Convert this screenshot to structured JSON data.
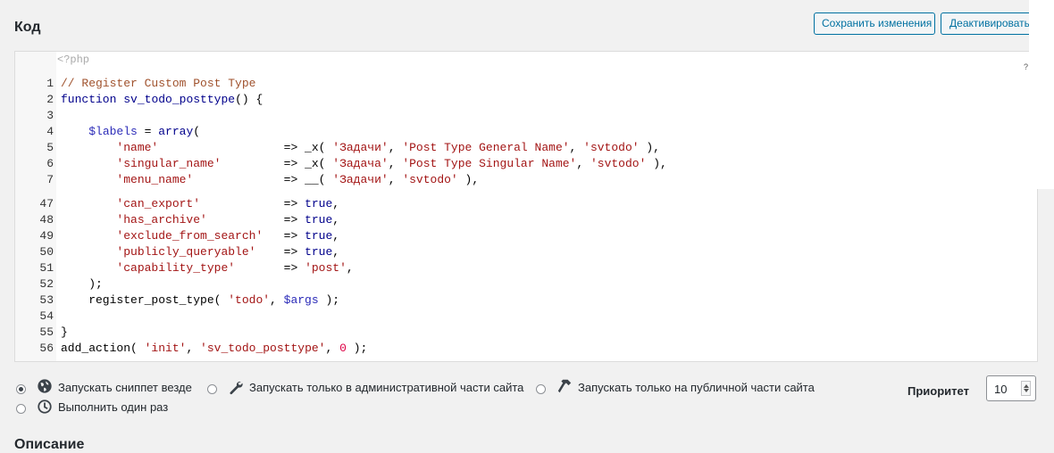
{
  "section_title": "Код",
  "buttons": {
    "save": "Сохранить изменения",
    "deactivate": "Деактивировать"
  },
  "editor": {
    "php_open": "<?php",
    "help_mark": "?",
    "lines": [
      {
        "n": "1",
        "html": "<span class=\"cm\">// Register Custom Post Type</span>"
      },
      {
        "n": "2",
        "html": "<span class=\"kw\">function</span> <span class=\"kw\">sv_todo_posttype</span>() {"
      },
      {
        "n": "3",
        "html": ""
      },
      {
        "n": "4",
        "html": "    <span class=\"var\">$labels</span> = <span class=\"kw\">array</span>("
      },
      {
        "n": "5",
        "html": "        <span class=\"str\">'name'</span>                  => _x( <span class=\"str\">'Задачи'</span>, <span class=\"str\">'Post Type General Name'</span>, <span class=\"str\">'svtodo'</span> ),"
      },
      {
        "n": "6",
        "html": "        <span class=\"str\">'singular_name'</span>         => _x( <span class=\"str\">'Задача'</span>, <span class=\"str\">'Post Type Singular Name'</span>, <span class=\"str\">'svtodo'</span> ),"
      },
      {
        "n": "7",
        "html": "        <span class=\"str\">'menu_name'</span>             => __( <span class=\"str\">'Задачи'</span>, <span class=\"str\">'svtodo'</span> ),"
      },
      {
        "n": "47",
        "html": "        <span class=\"str\">'can_export'</span>            => <span class=\"kw\">true</span>,"
      },
      {
        "n": "48",
        "html": "        <span class=\"str\">'has_archive'</span>           => <span class=\"kw\">true</span>,"
      },
      {
        "n": "49",
        "html": "        <span class=\"str\">'exclude_from_search'</span>   => <span class=\"kw\">true</span>,"
      },
      {
        "n": "50",
        "html": "        <span class=\"str\">'publicly_queryable'</span>    => <span class=\"kw\">true</span>,"
      },
      {
        "n": "51",
        "html": "        <span class=\"str\">'capability_type'</span>       => <span class=\"str\">'post'</span>,"
      },
      {
        "n": "52",
        "html": "    );"
      },
      {
        "n": "53",
        "html": "    register_post_type( <span class=\"str\">'todo'</span>, <span class=\"var\">$args</span> );"
      },
      {
        "n": "54",
        "html": ""
      },
      {
        "n": "55",
        "html": "}"
      },
      {
        "n": "56",
        "html": "add_action( <span class=\"str\">'init'</span>, <span class=\"str\">'sv_todo_posttype'</span>, <span class=\"num\">0</span> );"
      }
    ]
  },
  "run_options": {
    "everywhere": "Запускать сниппет везде",
    "admin_only": "Запускать только в административной части сайта",
    "public_only": "Запускать только на публичной части сайта",
    "once": "Выполнить один раз",
    "selected": "everywhere"
  },
  "priority": {
    "label": "Приоритет",
    "value": "10"
  },
  "description_title": "Описание"
}
